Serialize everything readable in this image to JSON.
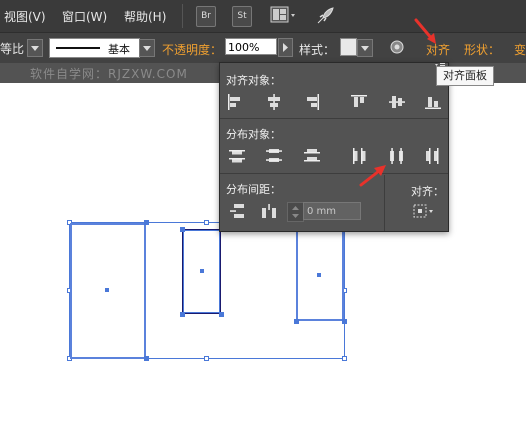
{
  "menubar": {
    "items": [
      "视图(V)",
      "窗口(W)",
      "帮助(H)"
    ],
    "br_button": "Br",
    "st_button": "St"
  },
  "controlbar": {
    "ratio_label": "等比",
    "stroke_label": "基本",
    "opacity_label": "不透明度：",
    "opacity_value": "100%",
    "style_label": "样式：",
    "align_link": "对齐",
    "shape_link": "形状：",
    "transform_link": "变"
  },
  "watermark": "软件自学网：RJZXW.COM",
  "panel": {
    "align_objects_title": "对齐对象：",
    "distribute_objects_title": "分布对象：",
    "distribute_spacing_title": "分布间距：",
    "spacing_value": "0 mm",
    "align_to_title": "对齐："
  },
  "tooltip": "对齐面板",
  "colors": {
    "selection": "#4a78d8",
    "arrow": "#e8322b",
    "orange_label": "#f0a030"
  }
}
